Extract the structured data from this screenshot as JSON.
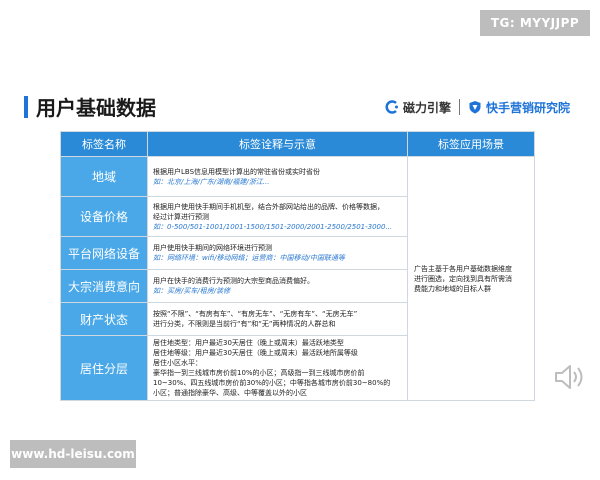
{
  "watermark_top": "TG: MYYJJPP",
  "watermark_bottom": "www.hd-leisu.com",
  "title": "用户基础数据",
  "brand": {
    "name1": "磁力引擎",
    "name2": "快手营销研究院"
  },
  "headers": {
    "col1": "标签名称",
    "col2": "标签诠释与示意",
    "col3": "标签应用场景"
  },
  "rows": [
    {
      "tag": "地域",
      "lines": [
        "根据用户LBS信息用模型计算出的常驻省份或实时省份"
      ],
      "example": "如：北京/上海/广东/湖南/福建/浙江..."
    },
    {
      "tag": "设备价格",
      "lines": [
        "根据用户使用快手期间手机机型，结合外部网站给出的品牌、价格等数据，",
        "经过计算进行预测"
      ],
      "example": "如：0-500/501-1001/1001-1500/1501-2000/2001-2500/2501-3000..."
    },
    {
      "tag": "平台网络设备",
      "lines": [
        "用户使用快手期间的网络环境进行预测"
      ],
      "example": "如：网络环境：wifi/移动网络；运营商：中国移动/中国联通等"
    },
    {
      "tag": "大宗消费意向",
      "lines": [
        "用户在快手的消费行为预测的大宗型商品消费偏好。"
      ],
      "example": "如：买房/买车/租房/装修"
    },
    {
      "tag": "财产状态",
      "lines": [
        "按照“不限”、“有房有车”、“有房无车”、“无房有车”、“无房无车”",
        "进行分类，不限则是当前行“有”和“无”两种情况的人群总和"
      ],
      "example": ""
    },
    {
      "tag": "居住分层",
      "lines": [
        "居住地类型：用户最近30天居住（晚上或周末）最活跃地类型",
        "居住地等级：用户最近30天居住（晚上或周末）最活跃地所属等级",
        "居住小区水平：",
        "豪华指一到三线城市房价前10%的小区；高级指一到三线城市房价前",
        "10~30%、四五线城市房价前30%的小区；中等指各城市房价前30~80%的",
        "小区；普通指除豪华、高级、中等覆盖以外的小区"
      ],
      "example": ""
    }
  ],
  "scene": [
    "广告主基于各用户基础数据维度",
    "进行圈选，定向找到具有所需消",
    "费能力和地域的目标人群"
  ]
}
